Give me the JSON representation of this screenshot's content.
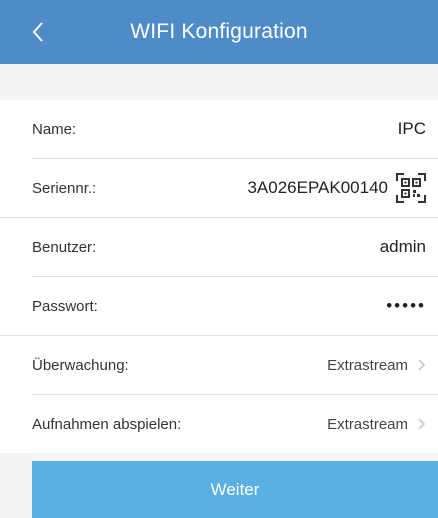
{
  "header": {
    "title": "WIFI Konfiguration",
    "back_icon": "chevron-left-icon",
    "background_color": "#4d8cc9"
  },
  "device": {
    "name_label": "Name:",
    "name_value": "IPC",
    "serial_label": "Seriennr.:",
    "serial_value": "3A026EPAK00140",
    "qr_icon": "qr-code-icon"
  },
  "credentials": {
    "user_label": "Benutzer:",
    "user_value": "admin",
    "password_label": "Passwort:",
    "password_value": "•••••"
  },
  "streams": {
    "monitoring_label": "Überwachung:",
    "monitoring_value": "Extrastream",
    "playback_label": "Aufnahmen abspielen:",
    "playback_value": "Extrastream",
    "chevron_icon": "chevron-right-icon"
  },
  "footer": {
    "next_label": "Weiter",
    "button_color": "#5aafe3"
  }
}
